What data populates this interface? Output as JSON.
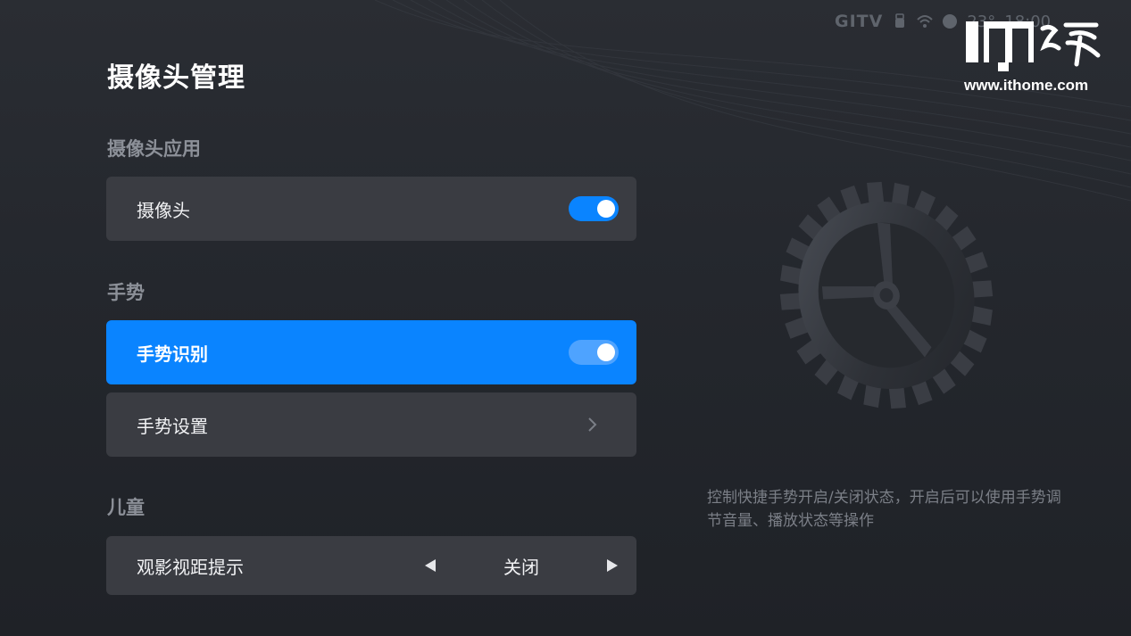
{
  "status_bar": {
    "brand": "GITV",
    "weather": "23°",
    "time": "18:00"
  },
  "watermark": {
    "logo_text": "IT之家",
    "site": "www.ithome.com"
  },
  "page": {
    "title": "摄像头管理"
  },
  "sections": {
    "camera_app": {
      "label": "摄像头应用",
      "items": [
        {
          "label": "摄像头",
          "toggle": true
        }
      ]
    },
    "gesture": {
      "label": "手势",
      "items": [
        {
          "label": "手势识别",
          "toggle": true,
          "focused": true
        },
        {
          "label": "手势设置"
        }
      ]
    },
    "children": {
      "label": "儿童",
      "items": [
        {
          "label": "观影视距提示",
          "value": "关闭"
        }
      ]
    }
  },
  "description": "控制快捷手势开启/关闭状态，开启后可以使用手势调节音量、播放状态等操作",
  "colors": {
    "accent": "#0a84ff",
    "row_bg": "#3a3c42",
    "background": "#24272d",
    "muted_text": "#8c9098"
  },
  "icons": {
    "wifi": "wifi-icon",
    "usb": "usb-icon",
    "account": "account-icon",
    "chevron": "chevron-right-icon",
    "gear": "gear-icon"
  }
}
